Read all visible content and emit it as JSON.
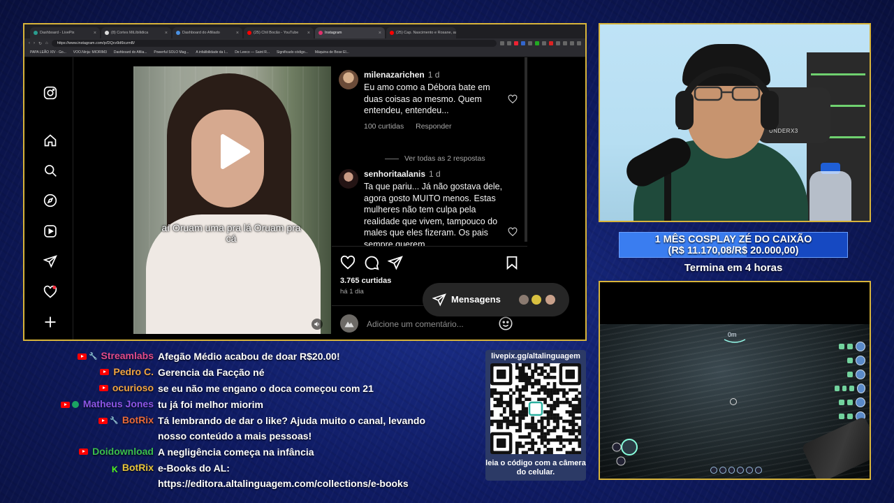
{
  "browser": {
    "tabs": [
      {
        "label": "Dashboard - LivePix",
        "color": "#2a9d8f",
        "active": false
      },
      {
        "label": "(8) Cortes MiLíbilidica",
        "color": "#dddddd",
        "active": false
      },
      {
        "label": "Dashboard do Afiliado",
        "color": "#4a90e2",
        "active": false
      },
      {
        "label": "(25) Chil Bocão - YouTube",
        "color": "#ff0000",
        "active": false
      },
      {
        "label": "Instagram",
        "color": "#e1306c",
        "active": true
      },
      {
        "label": "(25) Cap. Nascimento e Rosane, aux",
        "color": "#ff0000",
        "active": false
      }
    ],
    "url": "https://www.instagram.com/p/DQcv9d6iczmB/",
    "bookmarks": [
      "PAPA LEÃO XIV - Go...",
      "VOO.Ninja: MIORIM3",
      "Dashboard do Afilia...",
      "Powerful SOLO Mag...",
      "A infalibilidade da I...",
      "De Leeco — Saint R...",
      "Significado código...",
      "Máquina de Bose El..."
    ]
  },
  "instagram": {
    "video_caption": "aí Oruam uma pra lá Oruam pra cá",
    "comments": [
      {
        "user": "milenazarichen",
        "time": "1 d",
        "text": "Eu amo como a Débora bate em duas coisas ao mesmo. Quem entendeu, entendeu...",
        "likes": "100 curtidas",
        "reply": "Responder",
        "avatar_color": "#b58a6a"
      },
      {
        "user": "senhoritaalanis",
        "time": "1 d",
        "text": "Ta que pariu... Já não gostava dele, agora gosto MUITO menos. Estas mulheres não tem culpa pela realidade que vivem, tampouco do males que eles fizeram. Os pais sempre querem",
        "avatar_color": "#5a2a2a"
      }
    ],
    "view_replies": "Ver todas as 2 respostas",
    "likes_count": "3.765 curtidas",
    "posted_ago": "há 1 dia",
    "add_comment_placeholder": "Adicione um comentário...",
    "messages_label": "Mensagens"
  },
  "goal": {
    "title": "1 MÊS COSPLAY ZÉ DO CAIXÃO",
    "amount": "(R$ 11.170,08/R$ 20.000,00)",
    "progress": 0.5585,
    "ends": "Termina em 4 horas"
  },
  "webcam": {
    "chair_text": "UNDERX3"
  },
  "game": {
    "depth": "0m"
  },
  "chat": [
    {
      "user": "Streamlabs",
      "color": "#e24b8c",
      "badges": [
        "youtube",
        "wrench"
      ],
      "message": "Afegão Médio acabou de doar R$20.00!"
    },
    {
      "user": "Pedro C.",
      "color": "#f0a441",
      "badges": [
        "youtube"
      ],
      "message": "Gerencia da Facção né"
    },
    {
      "user": "ocurioso",
      "color": "#f0a441",
      "badges": [
        "youtube"
      ],
      "message": "se eu não me engano o doca começou com 21"
    },
    {
      "user": "Matheus Jones",
      "color": "#8d56e8",
      "badges": [
        "youtube",
        "member"
      ],
      "message": "tu já foi melhor miorim"
    },
    {
      "user": "BotRix",
      "color": "#e86a3a",
      "badges": [
        "youtube",
        "wrench"
      ],
      "message": "Tá lembrando de dar o like? Ajuda muito o canal, levando nosso conteúdo a mais pessoas!"
    },
    {
      "user": "Doidownload",
      "color": "#3bbf4e",
      "badges": [
        "youtube"
      ],
      "message": "A negligência começa na infância"
    },
    {
      "user": "BotRix",
      "color": "#e8c53a",
      "badges": [
        "kick"
      ],
      "message": "e-Books do AL: https://editora.altalinguagem.com/collections/e-books"
    }
  ],
  "qr": {
    "url": "livepix.gg/altalinguagem",
    "caption": "leia o código com a câmera do celular."
  }
}
